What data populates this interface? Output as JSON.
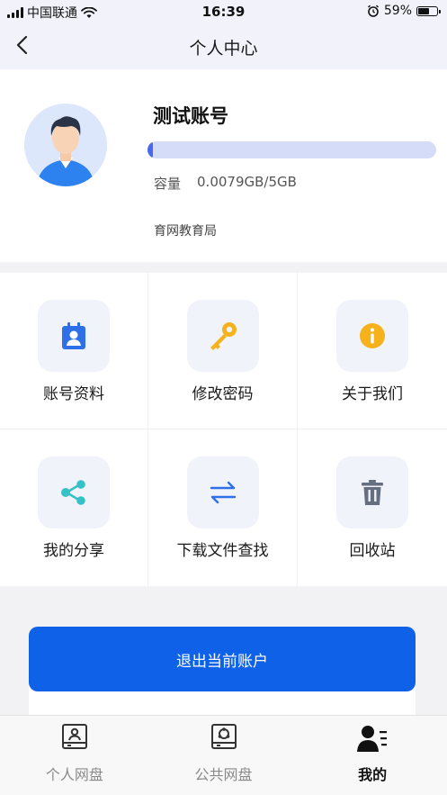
{
  "status_bar": {
    "carrier": "中国联通",
    "time": "16:39",
    "battery": "59%",
    "battery_level": 0.59
  },
  "header": {
    "title": "个人中心"
  },
  "profile": {
    "username": "测试账号",
    "capacity_label": "容量",
    "capacity_value": "0.0079GB/5GB",
    "capacity_fraction": 0.0016,
    "organization": "育网教育局"
  },
  "menu": {
    "items": [
      {
        "label": "账号资料",
        "icon": "contact-card-icon"
      },
      {
        "label": "修改密码",
        "icon": "key-icon"
      },
      {
        "label": "关于我们",
        "icon": "info-icon"
      },
      {
        "label": "我的分享",
        "icon": "share-icon"
      },
      {
        "label": "下载文件查找",
        "icon": "transfer-arrows-icon"
      },
      {
        "label": "回收站",
        "icon": "trash-icon"
      }
    ]
  },
  "logout": {
    "label": "退出当前账户"
  },
  "tabbar": {
    "tabs": [
      {
        "label": "个人网盘",
        "icon": "personal-disk-icon",
        "active": false
      },
      {
        "label": "公共网盘",
        "icon": "public-disk-icon",
        "active": false
      },
      {
        "label": "我的",
        "icon": "profile-menu-icon",
        "active": true
      }
    ]
  },
  "colors": {
    "accent": "#0f62e8",
    "capacity_track": "#d4dcf7",
    "capacity_fill": "#4a68ea",
    "key_icon": "#f5b21c",
    "info_icon": "#f5b21c",
    "share_icon": "#35c2c6",
    "contact_icon": "#2f6fe8",
    "transfer_icon": "#2f6fe8",
    "trash_icon": "#666f80"
  }
}
